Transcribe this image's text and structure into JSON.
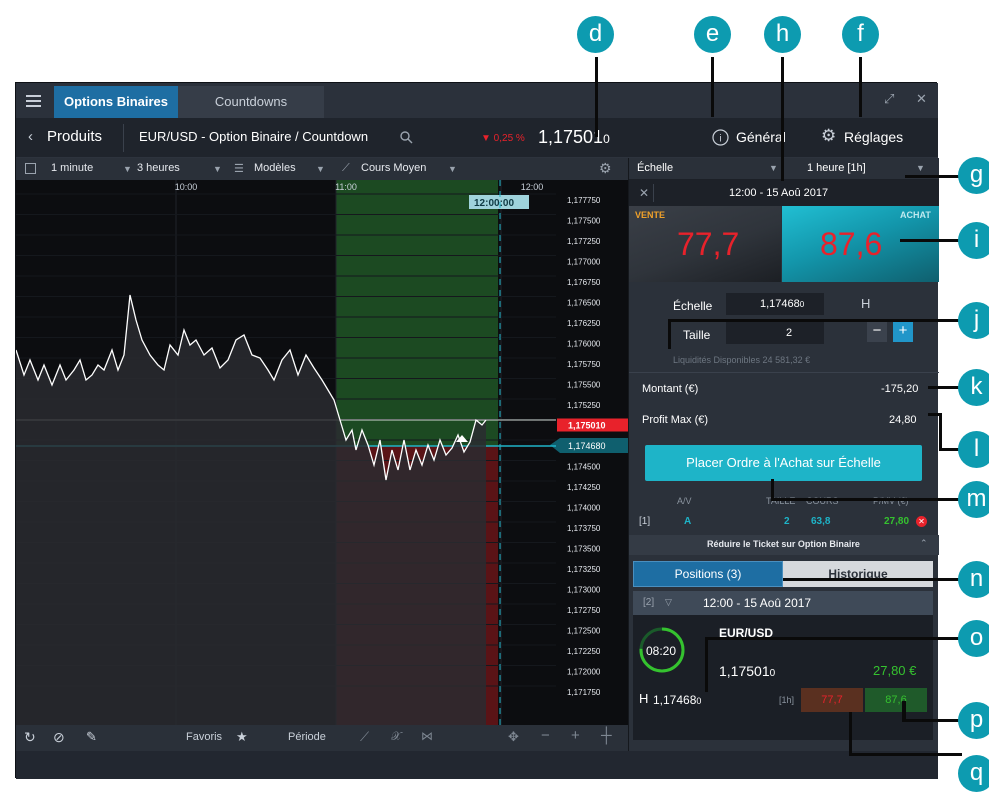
{
  "tabs": [
    {
      "label": "Options Binaires",
      "active": true
    },
    {
      "label": "Countdowns",
      "active": false
    }
  ],
  "header": {
    "back_label": "Produits",
    "instrument": "EUR/USD - Option Binaire / Countdown",
    "change": "▼ 0,25 %",
    "price": "1,17501",
    "price_small": "0",
    "general_label": "Général",
    "settings_label": "Réglages"
  },
  "toolbar": {
    "interval": "1 minute",
    "range": "3 heures",
    "models": "Modèles",
    "indicator": "Cours Moyen"
  },
  "chart": {
    "time_labels": [
      "10:00",
      "11:00",
      "12:00"
    ],
    "y_ticks": [
      "1,177750",
      "1,177500",
      "1,177250",
      "1,177000",
      "1,176750",
      "1,176500",
      "1,176250",
      "1,176000",
      "1,175750",
      "1,175500",
      "1,175250",
      "1,175010",
      "1,174680",
      "1,174500",
      "1,174250",
      "1,174000",
      "1,173750",
      "1,173500",
      "1,173250",
      "1,173000",
      "1,172750",
      "1,172500",
      "1,172250",
      "1,172000",
      "1,171750"
    ],
    "current_price_tag": "1,175010",
    "strike_tag": "1,174680",
    "countdown_tag": "12:00:00",
    "price_line_color": "#ffffff",
    "window_green": "#1c4a22",
    "window_red": "#5a1316"
  },
  "bottombar": {
    "favorites": "Favoris",
    "period": "Période"
  },
  "panel": {
    "scale_label": "Échelle",
    "period_select": "1 heure [1h]",
    "expiry_label": "12:00 - 15 Aoû 2017",
    "sell_label": "VENTE",
    "sell_price": "77,7",
    "buy_label": "ACHAT",
    "buy_price": "87,6",
    "echelle_field_label": "Échelle",
    "echelle_value": "1,17468",
    "echelle_value_small": "0",
    "size_label": "Taille",
    "size_value": "2",
    "liquidity": "Liquidités Disponibles 24 581,32 €",
    "amount_label": "Montant (€)",
    "amount_value": "-175,20",
    "profit_label": "Profit Max (€)",
    "profit_value": "24,80",
    "order_button": "Placer Ordre à l'Achat sur Échelle",
    "table_headers": [
      "A/V",
      "TAILLE",
      "COURS",
      "P/MV (€)"
    ],
    "table_row": {
      "idx": "[1]",
      "side": "A",
      "size": "2",
      "price": "63,8",
      "pl": "27,80"
    },
    "reduce_ticket": "Réduire le Ticket sur Option Binaire",
    "positions_tab": "Positions (3)",
    "history_tab": "Historique",
    "position_index": "[2]",
    "position_expiry": "12:00 - 15 Aoû 2017",
    "position_instrument": "EUR/USD",
    "position_price": "1,17501",
    "position_price_small": "0",
    "countdown": "08:20",
    "position_pl": "27,80 €",
    "position_strike": "1,17468",
    "position_strike_small": "0",
    "position_period": "[1h]",
    "position_sell": "77,7",
    "position_buy": "87,6"
  },
  "callouts": [
    "d",
    "e",
    "h",
    "f",
    "g",
    "i",
    "j",
    "k",
    "l",
    "m",
    "n",
    "o",
    "p",
    "q"
  ],
  "colors": {
    "accent": "#0d9bb0",
    "tab_active": "#1e6ea3",
    "buy": "#1eb4c8",
    "sell": "#e8222b",
    "profit": "#35c22f"
  }
}
